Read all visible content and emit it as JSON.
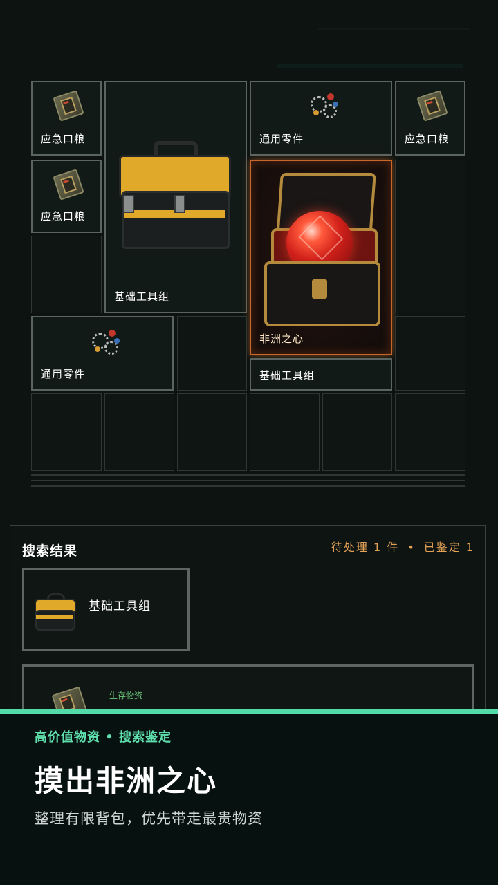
{
  "inventory": {
    "items": [
      {
        "label": "应急口粮",
        "icon": "ration-icon"
      },
      {
        "label": "基础工具组",
        "icon": "toolbox-icon"
      },
      {
        "label": "通用零件",
        "icon": "parts-icon"
      },
      {
        "label": "应急口粮",
        "icon": "ration-icon"
      },
      {
        "label": "应急口粮",
        "icon": "ration-icon"
      },
      {
        "label": "非洲之心",
        "icon": "gem-chest-icon",
        "highlighted": true
      },
      {
        "label": "通用零件",
        "icon": "parts-icon"
      },
      {
        "label": "基础工具组",
        "icon": "none"
      }
    ]
  },
  "search": {
    "title": "搜索结果",
    "pending": "待处理 1 件",
    "separator": "•",
    "identified": "已鉴定 1",
    "results": [
      {
        "name": "基础工具组",
        "icon": "toolbox-icon"
      },
      {
        "category": "生存物资",
        "name": "应急口粮",
        "icon": "ration-icon"
      }
    ]
  },
  "banner": {
    "tagline": "高价值物资 • 搜索鉴定",
    "headline": "摸出非洲之心",
    "subline": "整理有限背包，优先带走最贵物资"
  },
  "colors": {
    "accent": "#53dba9",
    "highlight_border": "#c9662b",
    "stats": "#e3a155"
  }
}
